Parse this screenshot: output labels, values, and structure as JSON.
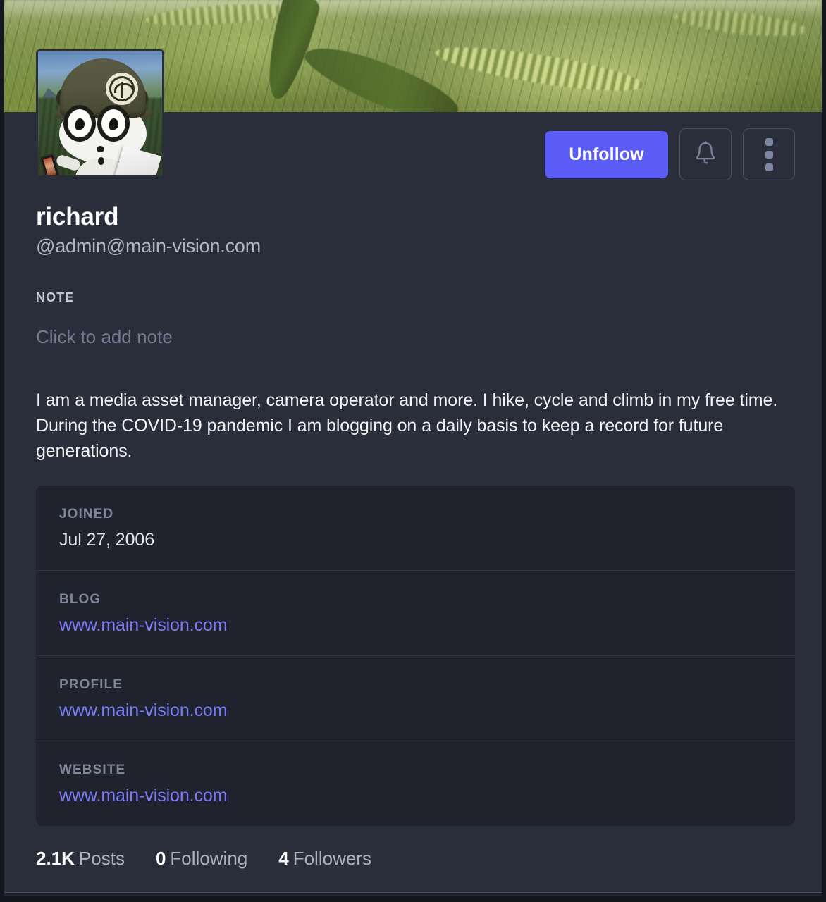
{
  "profile": {
    "display_name": "richard",
    "handle": "@admin@main-vision.com",
    "bio": "I am a media asset manager, camera operator and more. I hike, cycle and climb in my free time. During the COVID-19 pandemic I am blogging on a daily basis to keep a record for future generations.",
    "avatar_alt": "cartoon-mascot-with-helmet-avatar",
    "banner_alt": "green-wheat-field-header-image"
  },
  "actions": {
    "follow_button_label": "Unfollow",
    "notify_icon": "bell-icon",
    "more_icon": "three-dots-vertical-icon"
  },
  "note": {
    "label": "NOTE",
    "placeholder": "Click to add note",
    "value": ""
  },
  "metadata": [
    {
      "key": "JOINED",
      "value": "Jul 27, 2006",
      "is_link": false
    },
    {
      "key": "BLOG",
      "value": "www.main-vision.com",
      "is_link": true
    },
    {
      "key": "PROFILE",
      "value": "www.main-vision.com",
      "is_link": true
    },
    {
      "key": "WEBSITE",
      "value": "www.main-vision.com",
      "is_link": true
    }
  ],
  "stats": [
    {
      "count": "2.1K",
      "label": "Posts"
    },
    {
      "count": "0",
      "label": "Following"
    },
    {
      "count": "4",
      "label": "Followers"
    }
  ],
  "colors": {
    "accent": "#5a5cf5",
    "link": "#7b7bf7",
    "page_bg": "#2a2d3a",
    "panel_bg": "#20232e",
    "text_primary": "#ffffff",
    "text_muted": "#aab2c2"
  }
}
